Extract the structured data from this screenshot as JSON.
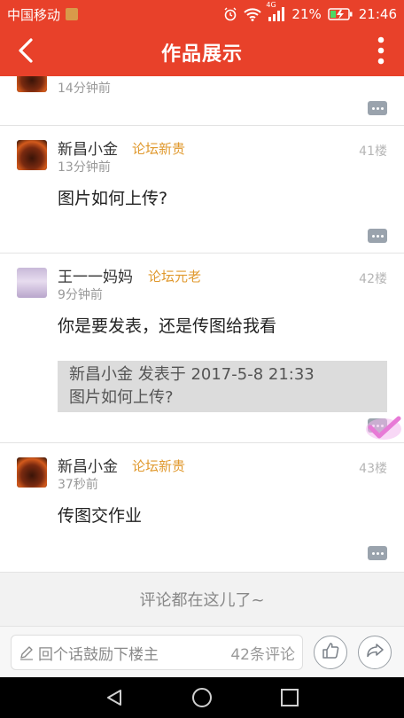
{
  "status_bar": {
    "carrier": "中国移动",
    "network": "4G",
    "battery_percent": "21%",
    "time": "21:46"
  },
  "app_bar": {
    "title": "作品展示",
    "back_icon": "back-arrow-icon",
    "more_icon": "more-vertical-icon"
  },
  "posts": [
    {
      "time": "14分钟前"
    },
    {
      "username": "新昌小金",
      "rank": "论坛新贵",
      "time": "13分钟前",
      "floor": "41楼",
      "text": "图片如何上传?"
    },
    {
      "username": "王一一妈妈",
      "rank": "论坛元老",
      "time": "9分钟前",
      "floor": "42楼",
      "text": "你是要发表，还是传图给我看",
      "quote": {
        "header": "新昌小金 发表于 2017-5-8 21:33",
        "text": "图片如何上传?"
      }
    },
    {
      "username": "新昌小金",
      "rank": "论坛新贵",
      "time": "37秒前",
      "floor": "43楼",
      "text": "传图交作业"
    }
  ],
  "end_message": "评论都在这儿了~",
  "input_bar": {
    "placeholder": "回个话鼓励下楼主",
    "comment_count": "42条评论",
    "like_icon": "thumbs-up-icon",
    "share_icon": "share-icon"
  },
  "colors": {
    "accent": "#e8412a",
    "rank": "#e0992e"
  }
}
